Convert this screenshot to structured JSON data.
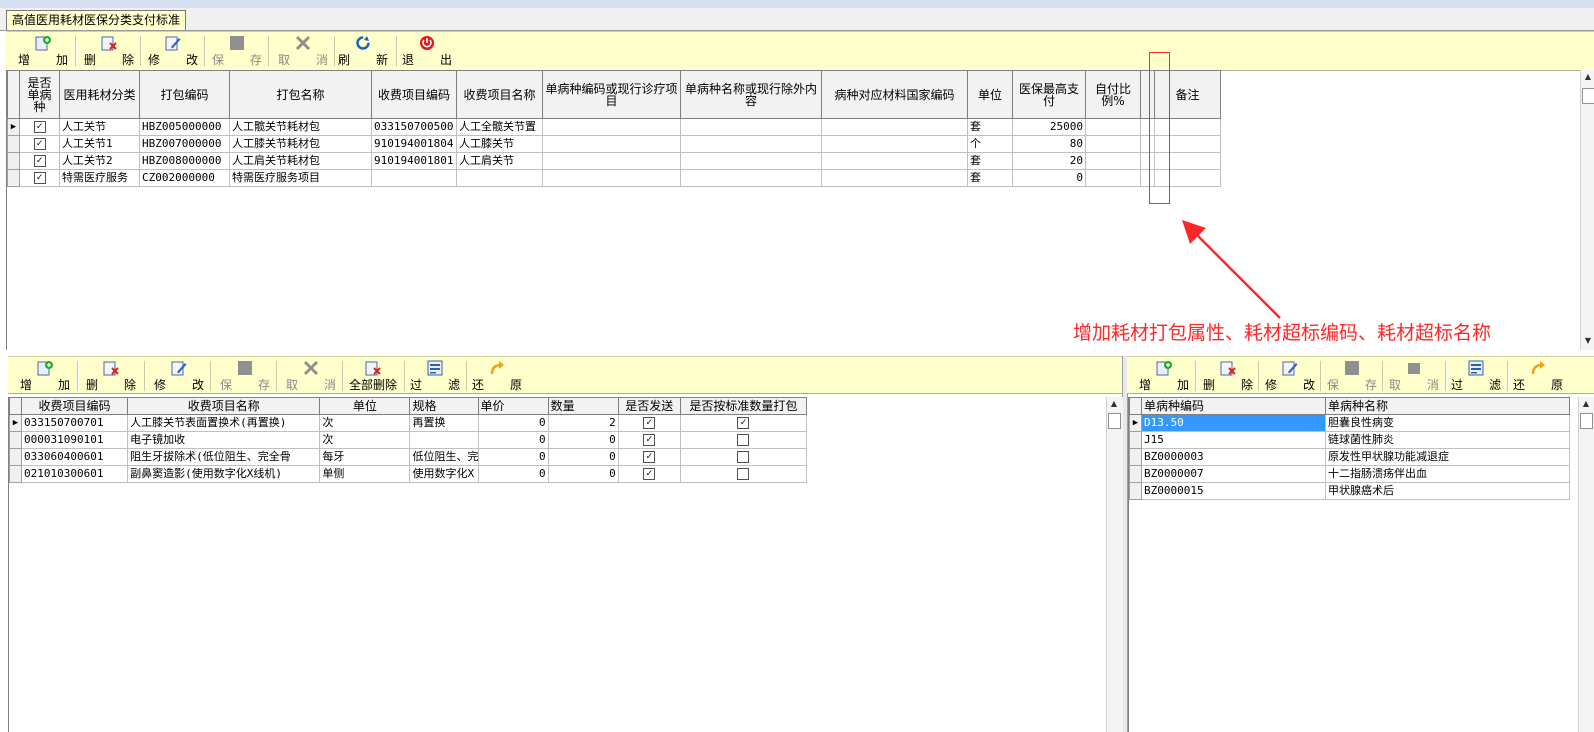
{
  "window": {
    "tab_title": "高值医用耗材医保分类支付标准"
  },
  "colors": {
    "toolbar_bg": "#ffffcc",
    "annotation_red": "#ff2828",
    "selection_blue": "#3399ff"
  },
  "toolbar_top": {
    "buttons": [
      {
        "icon": "add-icon",
        "l1": "增",
        "l2": "加",
        "enabled": true
      },
      {
        "icon": "delete-icon",
        "l1": "删",
        "l2": "除",
        "enabled": true
      },
      {
        "icon": "edit-icon",
        "l1": "修",
        "l2": "改",
        "enabled": true
      },
      {
        "icon": "save-icon",
        "l1": "保",
        "l2": "存",
        "enabled": false
      },
      {
        "icon": "cancel-icon",
        "l1": "取",
        "l2": "消",
        "enabled": false
      },
      {
        "icon": "refresh-icon",
        "l1": "刷",
        "l2": "新",
        "enabled": true
      },
      {
        "icon": "exit-icon",
        "l1": "退",
        "l2": "出",
        "enabled": true
      }
    ]
  },
  "main_table": {
    "headers": [
      "是否单病种",
      "医用耗材分类",
      "打包编码",
      "打包名称",
      "收费项目编码",
      "收费项目名称",
      "单病种编码或现行诊疗项目",
      "单病种名称或现行除外内容",
      "病种对应材料国家编码",
      "单位",
      "医保最高支付",
      "自付比例%",
      "",
      "备注"
    ],
    "rows": [
      {
        "checked": true,
        "category": "人工关节",
        "pkg_code": "HBZ005000000",
        "pkg_name": "人工髋关节耗材包",
        "fee_code": "033150700500",
        "fee_name": "人工全髋关节置",
        "dz_code": "",
        "dz_name": "",
        "nat_code": "",
        "unit": "套",
        "max_pay": "25000",
        "self_ratio": "",
        "extra": "",
        "remark": ""
      },
      {
        "checked": true,
        "category": "人工关节1",
        "pkg_code": "HBZ007000000",
        "pkg_name": "人工膝关节耗材包",
        "fee_code": "910194001804",
        "fee_name": "人工膝关节",
        "dz_code": "",
        "dz_name": "",
        "nat_code": "",
        "unit": "个",
        "max_pay": "80",
        "self_ratio": "",
        "extra": "",
        "remark": ""
      },
      {
        "checked": true,
        "category": "人工关节2",
        "pkg_code": "HBZ008000000",
        "pkg_name": "人工肩关节耗材包",
        "fee_code": "910194001801",
        "fee_name": "人工肩关节",
        "dz_code": "",
        "dz_name": "",
        "nat_code": "",
        "unit": "套",
        "max_pay": "20",
        "self_ratio": "",
        "extra": "",
        "remark": ""
      },
      {
        "checked": true,
        "category": "特需医疗服务",
        "pkg_code": "CZ002000000",
        "pkg_name": "特需医疗服务项目",
        "fee_code": "",
        "fee_name": "",
        "dz_code": "",
        "dz_name": "",
        "nat_code": "",
        "unit": "套",
        "max_pay": "0",
        "self_ratio": "",
        "extra": "",
        "remark": ""
      }
    ]
  },
  "annotation": {
    "text": "增加耗材打包属性、耗材超标编码、耗材超标名称"
  },
  "toolbar_left": {
    "buttons": [
      {
        "icon": "add-icon",
        "l1": "增",
        "l2": "加",
        "enabled": true
      },
      {
        "icon": "delete-icon",
        "l1": "删",
        "l2": "除",
        "enabled": true
      },
      {
        "icon": "edit-icon",
        "l1": "修",
        "l2": "改",
        "enabled": true
      },
      {
        "icon": "save-icon",
        "l1": "保",
        "l2": "存",
        "enabled": false
      },
      {
        "icon": "cancel-icon",
        "l1": "取",
        "l2": "消",
        "enabled": false
      },
      {
        "icon": "delete-all-icon",
        "l1": "全部删除",
        "l2": "",
        "enabled": true
      },
      {
        "icon": "filter-icon",
        "l1": "过",
        "l2": "滤",
        "enabled": true
      },
      {
        "icon": "restore-icon",
        "l1": "还",
        "l2": "原",
        "enabled": true
      }
    ]
  },
  "fee_table": {
    "headers": [
      "收费项目编码",
      "收费项目名称",
      "单位",
      "规格",
      "单价",
      "数量",
      "是否发送",
      "是否按标准数量打包"
    ],
    "rows": [
      {
        "code": "033150700701",
        "name": "人工膝关节表面置换术(再置换)",
        "unit": "次",
        "spec": "再置换",
        "price": "0",
        "qty": "2",
        "send": true,
        "std_pack": true
      },
      {
        "code": "000031090101",
        "name": "电子镜加收",
        "unit": "次",
        "spec": "",
        "price": "0",
        "qty": "0",
        "send": true,
        "std_pack": false
      },
      {
        "code": "033060400601",
        "name": "阻生牙拔除术(低位阻生、完全骨",
        "unit": "每牙",
        "spec": "低位阻生、完",
        "price": "0",
        "qty": "0",
        "send": true,
        "std_pack": false
      },
      {
        "code": "021010300601",
        "name": "副鼻窦造影(使用数字化X线机)",
        "unit": "单侧",
        "spec": "使用数字化X",
        "price": "0",
        "qty": "0",
        "send": true,
        "std_pack": false
      }
    ]
  },
  "toolbar_right": {
    "buttons": [
      {
        "icon": "add-icon",
        "l1": "增",
        "l2": "加",
        "enabled": true
      },
      {
        "icon": "delete-icon",
        "l1": "删",
        "l2": "除",
        "enabled": true
      },
      {
        "icon": "edit-icon",
        "l1": "修",
        "l2": "改",
        "enabled": true
      },
      {
        "icon": "save-icon",
        "l1": "保",
        "l2": "存",
        "enabled": false
      },
      {
        "icon": "cancel-icon",
        "l1": "取",
        "l2": "消",
        "enabled": false
      },
      {
        "icon": "filter-icon",
        "l1": "过",
        "l2": "滤",
        "enabled": true
      },
      {
        "icon": "restore-icon",
        "l1": "还",
        "l2": "原",
        "enabled": true
      }
    ]
  },
  "disease_table": {
    "headers": [
      "单病种编码",
      "单病种名称"
    ],
    "rows": [
      {
        "code": "D13.50",
        "name": "胆囊良性病变"
      },
      {
        "code": "J15",
        "name": "链球菌性肺炎"
      },
      {
        "code": "BZ0000003",
        "name": "原发性甲状腺功能减退症"
      },
      {
        "code": "BZ0000007",
        "name": "十二指肠溃疡伴出血"
      },
      {
        "code": "BZ0000015",
        "name": "甲状腺癌术后"
      }
    ]
  }
}
